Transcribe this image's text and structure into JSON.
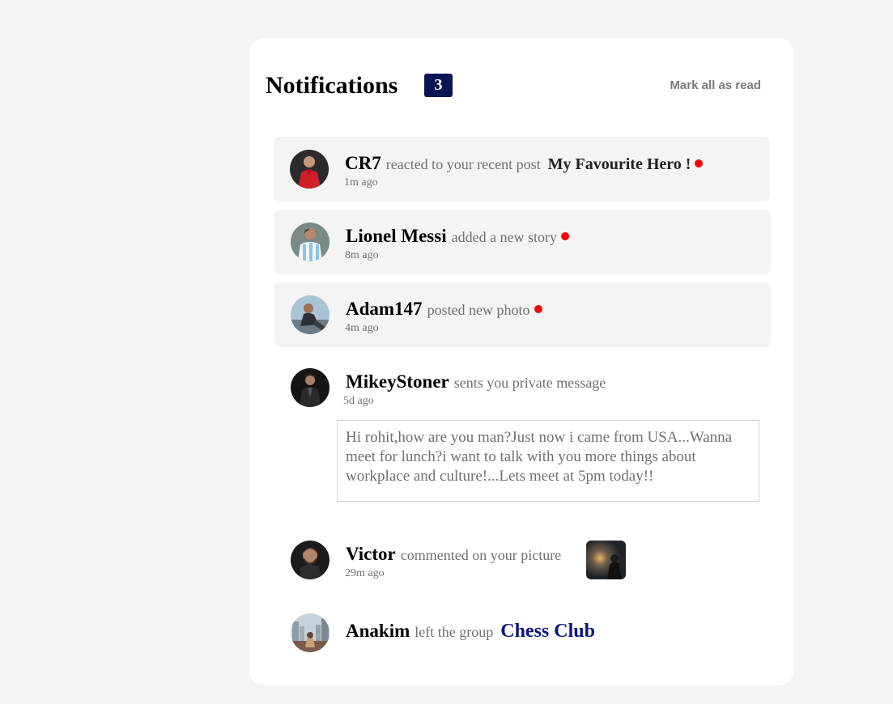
{
  "header": {
    "title": "Notifications",
    "unread_count": "3",
    "mark_all_label": "Mark all as read"
  },
  "notifications": [
    {
      "name": "CR7",
      "action": "reacted to your recent post",
      "target": "My Favourite Hero !",
      "time": "1m ago",
      "unread": true,
      "avatar": "avatar-cr7"
    },
    {
      "name": "Lionel Messi",
      "action": "added a new story",
      "time": "8m ago",
      "unread": true,
      "avatar": "avatar-messi"
    },
    {
      "name": "Adam147",
      "action": "posted new photo",
      "time": "4m ago",
      "unread": true,
      "avatar": "avatar-adam"
    },
    {
      "name": "MikeyStoner",
      "action": "sents you private message",
      "time": "5d ago",
      "unread": false,
      "message": "Hi rohit,how are you man?Just now i came from USA...Wanna meet for lunch?i want to talk with you more things about workplace and culture!...Lets meet at 5pm today!!",
      "avatar": "avatar-mikey"
    },
    {
      "name": "Victor",
      "action": "commented on your picture",
      "time": "29m ago",
      "unread": false,
      "picture": "picture-thumbnail",
      "avatar": "avatar-victor"
    },
    {
      "name": "Anakim",
      "action": "left the group",
      "target": "Chess Club",
      "unread": false,
      "avatar": "avatar-anakim"
    }
  ],
  "colors": {
    "page_background": "#f4f4f4",
    "card_background": "#ffffff",
    "unread_background": "#f4f4f4",
    "badge": "#0c1553",
    "unread_dot": "#ff0000",
    "group_link": "#0c1580",
    "muted_text": "#707070"
  }
}
